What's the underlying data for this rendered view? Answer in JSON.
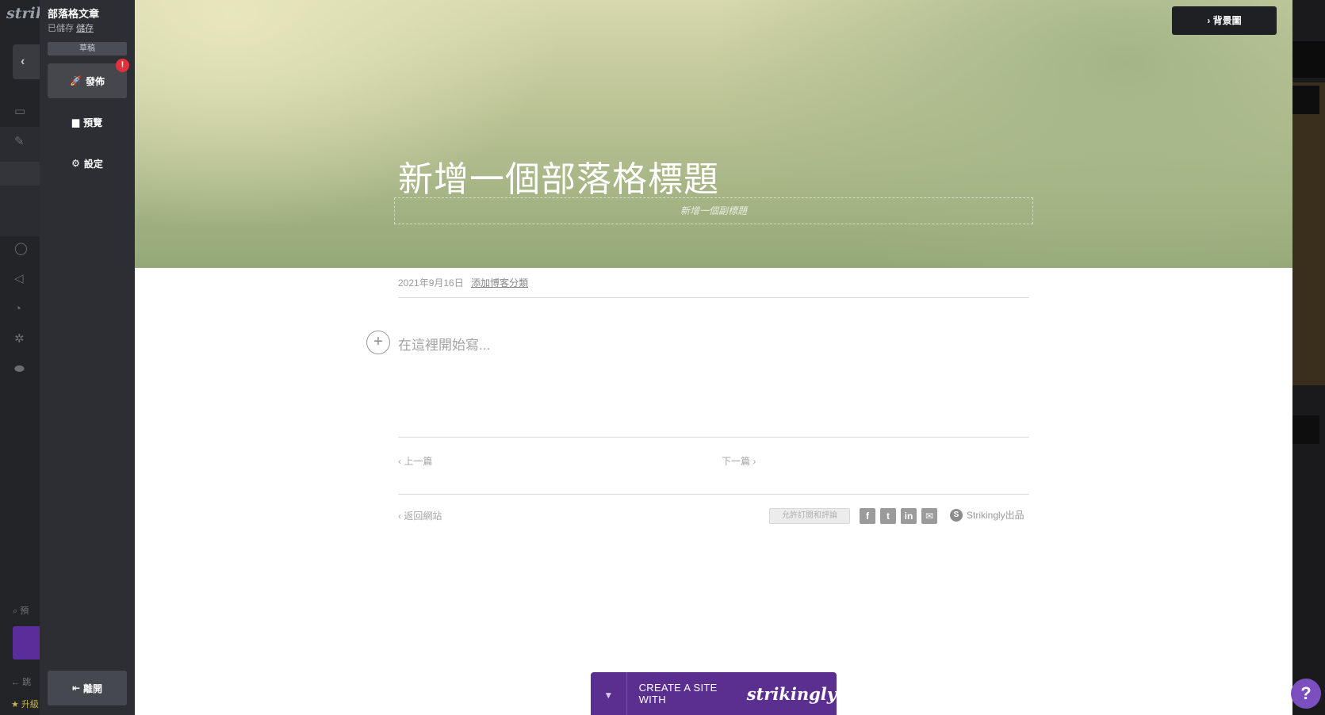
{
  "background_dashboard": {
    "logo": "strik",
    "search_label": "預",
    "bottom_link": "跳",
    "upgrade_label": "升級"
  },
  "panel": {
    "title": "部落格文章",
    "status": "已儲存",
    "save_link": "儲存",
    "draft_badge": "草稿",
    "publish_label": "發佈",
    "publish_alert": "!",
    "preview_label": "預覽",
    "settings_label": "設定",
    "leave_label": "離開"
  },
  "hero": {
    "bg_image_button": "背景圖",
    "title": "新增一個部落格標題",
    "subtitle_placeholder": "新增一個副標題"
  },
  "post": {
    "date": "2021年9月16日",
    "add_category": "添加博客分類",
    "write_placeholder": "在這裡開始寫...",
    "prev": "上一篇",
    "next": "下一篇",
    "back_to_site": "返回網站",
    "allow_comments": "允許訂閱和評論",
    "share_icons": [
      "facebook-icon",
      "twitter-icon",
      "linkedin-icon",
      "email-icon"
    ],
    "powered_by": "Strikingly出品"
  },
  "cta": {
    "text": "CREATE A SITE WITH",
    "brand": "strikingly"
  },
  "help": {
    "label": "?"
  },
  "colors": {
    "panel_bg": "#2d2e33",
    "cta_purple": "#5a2f8f",
    "alert_red": "#e0313c",
    "help_purple": "#7b4fc0"
  }
}
